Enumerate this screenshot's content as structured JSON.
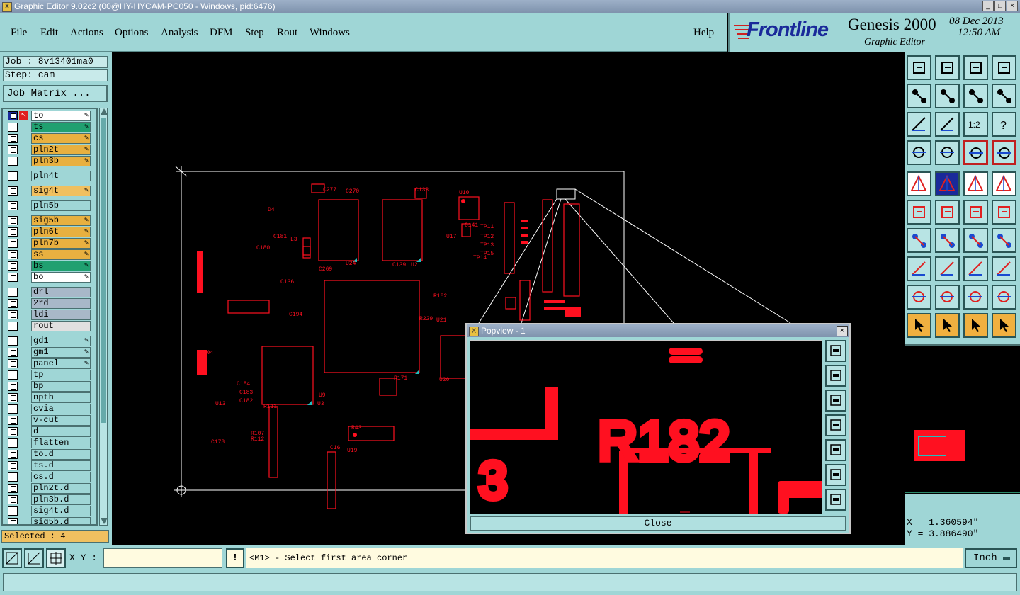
{
  "window": {
    "title": "Graphic Editor 9.02c2 (00@HY-HYCAM-PC050 - Windows, pid:6476)",
    "buttons": [
      "_",
      "□",
      "×"
    ]
  },
  "menu": [
    "File",
    "Edit",
    "Actions",
    "Options",
    "Analysis",
    "DFM",
    "Step",
    "Rout",
    "Windows"
  ],
  "help": "Help",
  "logo": {
    "brand": "Frontline",
    "product": "Genesis 2000",
    "subtitle": "Graphic Editor",
    "date": "08 Dec 2013",
    "time": "12:50 AM"
  },
  "left": {
    "job": "Job : 8v13401ma0",
    "step": "Step: cam",
    "job_matrix": "Job Matrix ...",
    "selected": "Selected : 4",
    "layers": [
      {
        "name": "to",
        "color": "#ffffff",
        "active": true
      },
      {
        "name": "ts",
        "color": "#20a070"
      },
      {
        "name": "cs",
        "color": "#e8b040"
      },
      {
        "name": "pln2t",
        "color": "#e8b040"
      },
      {
        "name": "pln3b",
        "color": "#e8b040"
      },
      {
        "name": "pln4t",
        "color": "#9fd6d6"
      },
      {
        "name": "sig4t",
        "color": "#f0c060"
      },
      {
        "name": "pln5b",
        "color": "#9fd6d6"
      },
      {
        "name": "sig5b",
        "color": "#e8b040"
      },
      {
        "name": "pln6t",
        "color": "#e8b040"
      },
      {
        "name": "pln7b",
        "color": "#e8b040"
      },
      {
        "name": "ss",
        "color": "#e8b040"
      },
      {
        "name": "bs",
        "color": "#20a070"
      },
      {
        "name": "bo",
        "color": "#ffffff"
      },
      {
        "name": "drl",
        "color": "#a8b8c8"
      },
      {
        "name": "2rd",
        "color": "#a8b8c8"
      },
      {
        "name": "ldi",
        "color": "#a8b8c8"
      },
      {
        "name": "rout",
        "color": "#e0e0e0"
      },
      {
        "name": "gd1",
        "color": "#9fd6d6"
      },
      {
        "name": "gm1",
        "color": "#9fd6d6"
      },
      {
        "name": "panel",
        "color": "#9fd6d6"
      },
      {
        "name": "tp",
        "color": "#9fd6d6"
      },
      {
        "name": "bp",
        "color": "#9fd6d6"
      },
      {
        "name": "npth",
        "color": "#9fd6d6"
      },
      {
        "name": "cvia",
        "color": "#9fd6d6"
      },
      {
        "name": "v-cut",
        "color": "#9fd6d6"
      },
      {
        "name": "d",
        "color": "#9fd6d6"
      },
      {
        "name": "flatten",
        "color": "#9fd6d6"
      },
      {
        "name": "to.d",
        "color": "#9fd6d6"
      },
      {
        "name": "ts.d",
        "color": "#9fd6d6"
      },
      {
        "name": "cs.d",
        "color": "#9fd6d6"
      },
      {
        "name": "pln2t.d",
        "color": "#9fd6d6"
      },
      {
        "name": "pln3b.d",
        "color": "#9fd6d6"
      },
      {
        "name": "sig4t.d",
        "color": "#9fd6d6"
      },
      {
        "name": "sig5b.d",
        "color": "#9fd6d6"
      }
    ]
  },
  "pcb_labels": [
    "C277",
    "C270",
    "C269",
    "U24",
    "C139",
    "U2",
    "C133",
    "U10",
    "U17",
    "C141",
    "TP11",
    "TP12",
    "TP13",
    "TP15",
    "TP14",
    "R182",
    "C180",
    "C181",
    "L3",
    "R229",
    "U21",
    "R204",
    "C184",
    "C183",
    "C182",
    "U13",
    "R111",
    "U3",
    "U9",
    "R107",
    "R112",
    "U19",
    "U20",
    "R171",
    "C178",
    "C16",
    "R43",
    "D4",
    "C136",
    "C194"
  ],
  "popview": {
    "title": "Popview - 1",
    "close": "Close",
    "text": "R182",
    "digit": "3"
  },
  "coords": {
    "x": "X = 1.360594\"",
    "y": "Y = 3.886490\""
  },
  "status": {
    "xy_label": "X Y :",
    "xy_value": "",
    "prompt": "<M1> - Select first area corner",
    "units": "Inch",
    "bang": "!"
  },
  "colors": {
    "panel": "#9fd6d6",
    "pcb": "#ff1020",
    "highlight": "#20c0c0"
  }
}
